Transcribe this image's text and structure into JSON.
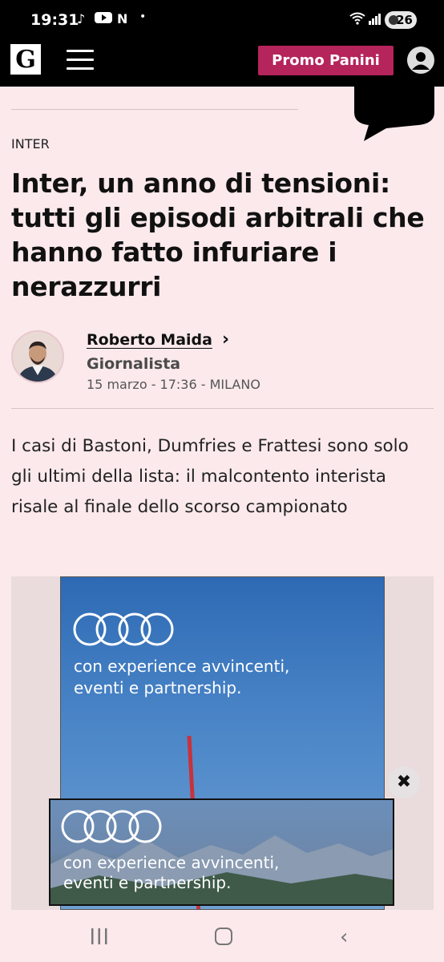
{
  "status_bar": {
    "time": "19:31",
    "app_icons": [
      "tiktok-icon",
      "youtube-icon",
      "n-icon"
    ],
    "battery": "26"
  },
  "header": {
    "logo": "G",
    "promo_label": "Promo Panini"
  },
  "article": {
    "category": "INTER",
    "headline": "Inter, un anno di tensioni: tutti gli episodi arbitrali che hanno fatto infuriare i nerazzurri",
    "author": {
      "name": "Roberto Maida",
      "role": "Giornalista",
      "dateline": "15 marzo - 17:36 - MILANO"
    },
    "summary": "I casi di Bastoni, Dumfries e Frattesi sono solo gli ultimi della lista: il malcontento interista risale al finale dello scorso campionato"
  },
  "ads": {
    "banner_text_line1": "con experience avvincenti,",
    "banner_text_line2": "eventi e partnership.",
    "sticky_text_line1": "con experience avvincenti,",
    "sticky_text_line2": "eventi e partnership."
  },
  "colors": {
    "brand_accent": "#b5245a",
    "page_background": "#fbe9ec",
    "header_background": "#000000"
  }
}
